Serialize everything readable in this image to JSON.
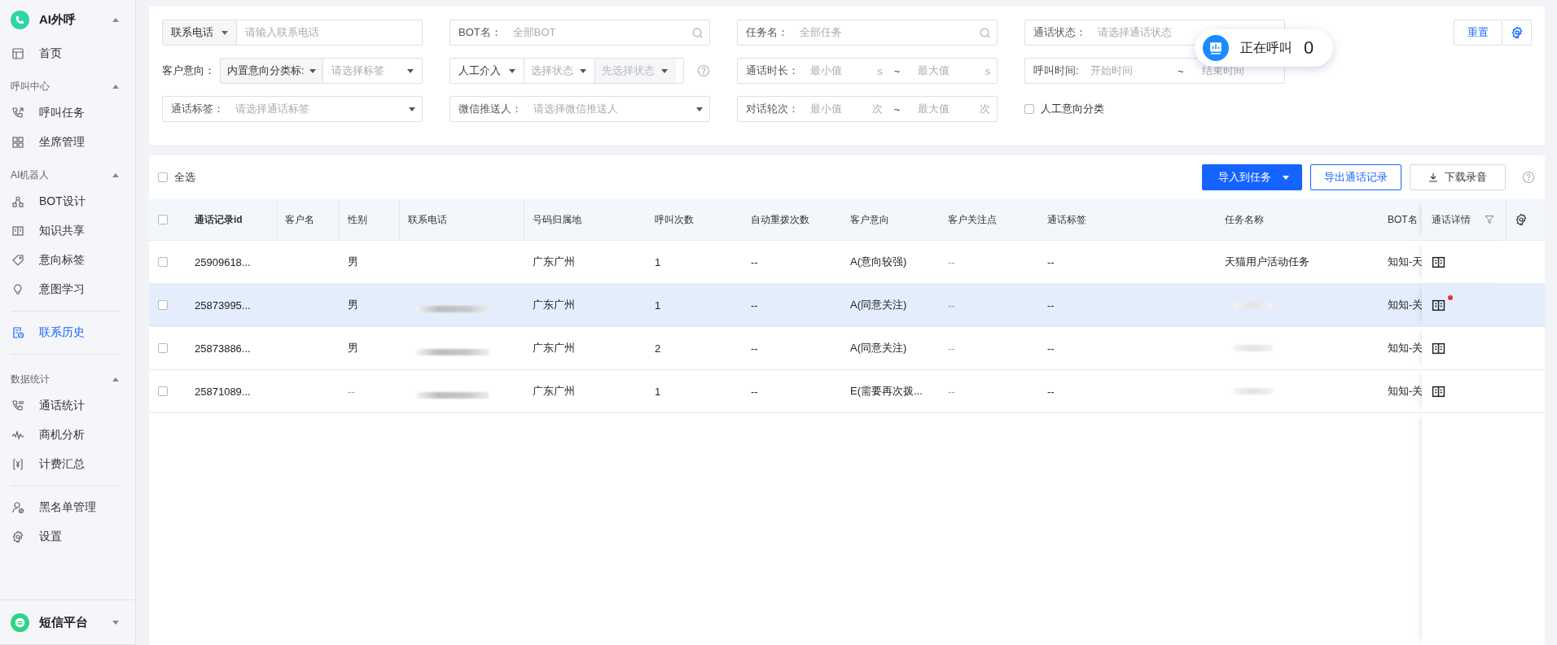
{
  "sidebar": {
    "app": {
      "title": "AI外呼",
      "expanded": true
    },
    "sections": [
      {
        "items": [
          {
            "label": "首页",
            "selected": false
          }
        ]
      },
      {
        "title": "呼叫中心",
        "expanded": true,
        "items": [
          {
            "label": "呼叫任务",
            "selected": false
          },
          {
            "label": "坐席管理",
            "selected": false
          }
        ]
      },
      {
        "title": "AI机器人",
        "expanded": true,
        "items": [
          {
            "label": "BOT设计",
            "selected": false
          },
          {
            "label": "知识共享",
            "selected": false
          },
          {
            "label": "意向标签",
            "selected": false
          },
          {
            "label": "意图学习",
            "selected": false
          }
        ]
      },
      {
        "divider": true,
        "items": [
          {
            "label": "联系历史",
            "selected": true
          }
        ]
      },
      {
        "divider": true,
        "title": "数据统计",
        "expanded": true,
        "items": [
          {
            "label": "通话统计",
            "selected": false
          },
          {
            "label": "商机分析",
            "selected": false
          },
          {
            "label": "计费汇总",
            "selected": false
          }
        ]
      },
      {
        "divider": true,
        "items": [
          {
            "label": "黑名单管理",
            "selected": false
          },
          {
            "label": "设置",
            "selected": false
          }
        ]
      }
    ],
    "footer_app": {
      "title": "短信平台",
      "expanded": false
    }
  },
  "filters": [
    {
      "kind": "select-input",
      "select": "联系电话",
      "placeholder": "请输入联系电话"
    },
    {
      "kind": "search",
      "label": "BOT名：",
      "placeholder": "全部BOT"
    },
    {
      "kind": "search",
      "label": "任务名：",
      "placeholder": "全部任务"
    },
    {
      "kind": "select",
      "label": "通话状态：",
      "placeholder": "请选择通话状态"
    },
    {
      "kind": "intent",
      "label": "客户意向：",
      "select": "内置意向分类标:",
      "placeholder": "请选择标签"
    },
    {
      "kind": "manual",
      "select": "人工介入",
      "state_placeholder": "选择状态",
      "sub_placeholder": "先选择状态",
      "sub_disabled": true
    },
    {
      "kind": "range",
      "label": "通话时长：",
      "min_placeholder": "最小值",
      "min_unit": "s",
      "separator": "~",
      "max_placeholder": "最大值",
      "max_unit": "s"
    },
    {
      "kind": "daterange",
      "label": "呼叫时间:",
      "start_placeholder": "开始时间",
      "separator": "~",
      "end_placeholder": "结束时间"
    },
    {
      "kind": "select",
      "label": "通话标签：",
      "placeholder": "请选择通话标签"
    },
    {
      "kind": "select",
      "label": "微信推送人：",
      "placeholder": "请选择微信推送人"
    },
    {
      "kind": "range",
      "label": "对话轮次：",
      "min_placeholder": "最小值",
      "min_unit": "次",
      "separator": "~",
      "max_placeholder": "最大值",
      "max_unit": "次"
    },
    {
      "kind": "checkbox",
      "label": "人工意向分类",
      "checked": false
    }
  ],
  "reset_button": "重置",
  "calling": {
    "label": "正在呼叫",
    "count": "0"
  },
  "toolbar": {
    "select_all": {
      "label": "全选",
      "checked": false
    },
    "import_button": "导入到任务",
    "export_button": "导出通话记录",
    "download_button": "下载录音"
  },
  "table": {
    "header_checked": false,
    "columns": [
      "通话记录id",
      "客户名",
      "性别",
      "联系电话",
      "号码归属地",
      "呼叫次数",
      "自动重拨次数",
      "客户意向",
      "客户关注点",
      "通话标签",
      "任务名称",
      "BOT名",
      "通话详情"
    ],
    "rows": [
      {
        "checked": false,
        "highlighted": false,
        "id": "25909618...",
        "gender": "男",
        "region": "广东广州",
        "calls": "1",
        "redials": "--",
        "intent": "A(意向较强)",
        "focus": "--",
        "tags": "--",
        "task": "天猫用户活动任务",
        "bot": "知知-天"
      },
      {
        "checked": false,
        "highlighted": true,
        "id": "25873995...",
        "gender": "男",
        "phone_redacted": true,
        "region": "广东广州",
        "calls": "1",
        "redials": "--",
        "intent": "A(同意关注)",
        "focus": "--",
        "tags": "--",
        "task_redacted": true,
        "bot": "知知-关",
        "unread": true
      },
      {
        "checked": false,
        "highlighted": false,
        "id": "25873886...",
        "gender": "男",
        "phone_redacted": true,
        "region": "广东广州",
        "calls": "2",
        "redials": "--",
        "intent": "A(同意关注)",
        "focus": "--",
        "tags": "--",
        "task_redacted": true,
        "bot": "知知-关"
      },
      {
        "checked": false,
        "highlighted": false,
        "id": "25871089...",
        "gender": "--",
        "phone_redacted": true,
        "region": "广东广州",
        "calls": "1",
        "redials": "--",
        "intent": "E(需要再次拨...",
        "focus": "--",
        "tags": "--",
        "task_redacted": true,
        "bot": "知知-关"
      }
    ]
  }
}
